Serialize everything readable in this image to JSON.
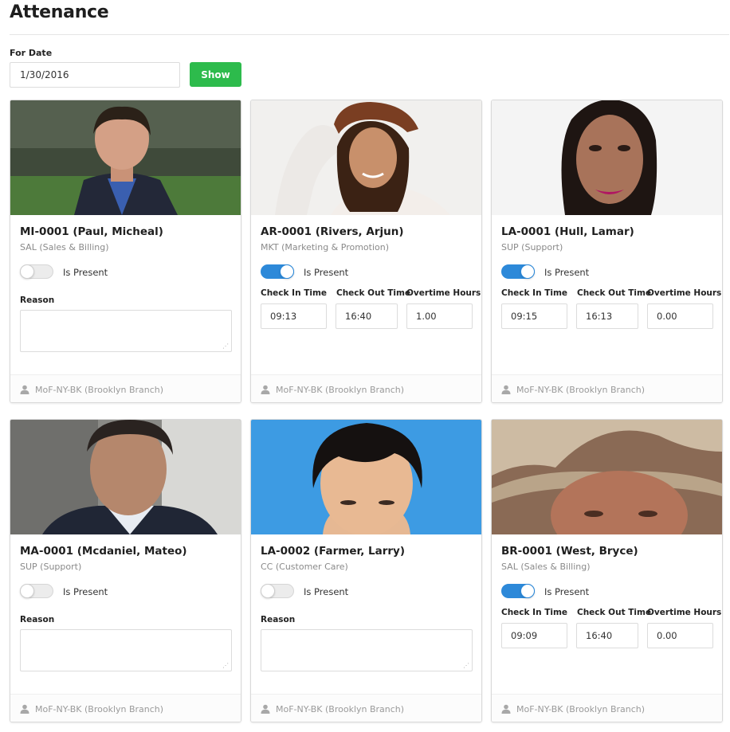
{
  "page": {
    "title": "Attenance"
  },
  "filter": {
    "date_label": "For Date",
    "date_value": "1/30/2016",
    "show_label": "Show"
  },
  "labels": {
    "is_present": "Is Present",
    "reason": "Reason",
    "check_in": "Check In Time",
    "check_out": "Check Out Time",
    "overtime": "Overtime Hours"
  },
  "colors": {
    "accent": "#2d89d9",
    "show_button": "#2dbb4c"
  },
  "employees": [
    {
      "name": "MI-0001 (Paul, Micheal)",
      "dept": "SAL (Sales & Billing)",
      "present": false,
      "check_in": "",
      "check_out": "",
      "overtime": "",
      "branch": "MoF-NY-BK (Brooklyn Branch)",
      "photo_icon": "portrait-man-outdoor"
    },
    {
      "name": "AR-0001 (Rivers, Arjun)",
      "dept": "MKT (Marketing & Promotion)",
      "present": true,
      "check_in": "09:13",
      "check_out": "16:40",
      "overtime": "1.00",
      "branch": "MoF-NY-BK (Brooklyn Branch)",
      "photo_icon": "portrait-woman-hat"
    },
    {
      "name": "LA-0001 (Hull, Lamar)",
      "dept": "SUP (Support)",
      "present": true,
      "check_in": "09:15",
      "check_out": "16:13",
      "overtime": "0.00",
      "branch": "MoF-NY-BK (Brooklyn Branch)",
      "photo_icon": "portrait-woman"
    },
    {
      "name": "MA-0001 (Mcdaniel, Mateo)",
      "dept": "SUP (Support)",
      "present": false,
      "check_in": "",
      "check_out": "",
      "overtime": "",
      "branch": "MoF-NY-BK (Brooklyn Branch)",
      "photo_icon": "portrait-man-suit"
    },
    {
      "name": "LA-0002 (Farmer, Larry)",
      "dept": "CC (Customer Care)",
      "present": false,
      "check_in": "",
      "check_out": "",
      "overtime": "",
      "branch": "MoF-NY-BK (Brooklyn Branch)",
      "photo_icon": "portrait-man-blue-bg"
    },
    {
      "name": "BR-0001 (West, Bryce)",
      "dept": "SAL (Sales & Billing)",
      "present": true,
      "check_in": "09:09",
      "check_out": "16:40",
      "overtime": "0.00",
      "branch": "MoF-NY-BK (Brooklyn Branch)",
      "photo_icon": "portrait-man-cowboy-hat"
    }
  ]
}
